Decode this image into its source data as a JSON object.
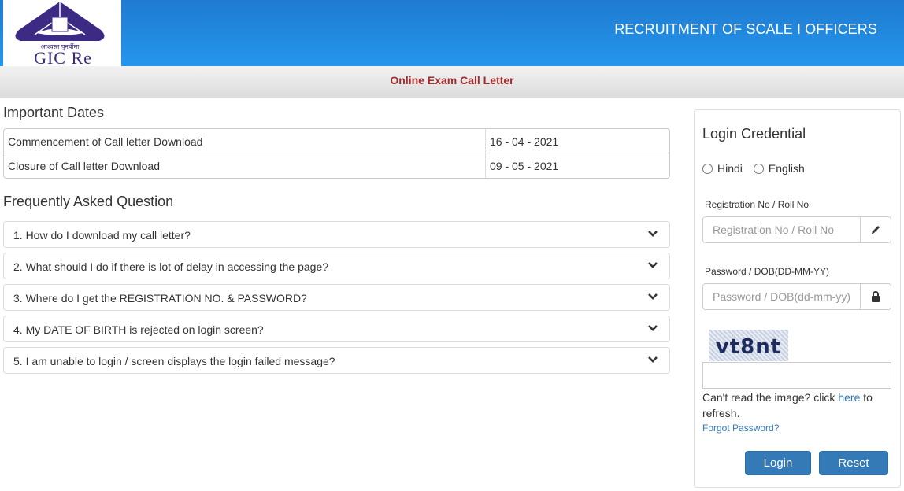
{
  "header": {
    "logo_text": "GIC Re",
    "logo_subtext": "आश्वस्त पुनर्बीमा",
    "title": "RECRUITMENT OF SCALE I OFFICERS",
    "colors": {
      "header_blue": "#2496ec",
      "subtitle_red": "#a52a2a",
      "button_blue": "#337ab7",
      "logo_purple": "#3d2a85"
    }
  },
  "subbar": {
    "title": "Online Exam Call Letter"
  },
  "important_dates": {
    "heading": "Important Dates",
    "rows": [
      {
        "label": "Commencement of Call letter Download",
        "value": "16 - 04 - 2021"
      },
      {
        "label": "Closure of Call letter Download",
        "value": "09 - 05 - 2021"
      }
    ]
  },
  "faq": {
    "heading": "Frequently Asked Question",
    "items": [
      {
        "question": "1. How do I download my call letter?",
        "icon": "chevron-down-icon"
      },
      {
        "question": "2. What should I do if there is lot of delay in accessing the page?",
        "icon": "chevron-down-icon"
      },
      {
        "question": "3. Where do I get the REGISTRATION NO. & PASSWORD?",
        "icon": "chevron-down-icon"
      },
      {
        "question": "4. My DATE OF BIRTH is rejected on login screen?",
        "icon": "chevron-down-icon"
      },
      {
        "question": "5. I am unable to login / screen displays the login failed message?",
        "icon": "chevron-down-icon"
      }
    ]
  },
  "login": {
    "title": "Login Credential",
    "languages": [
      {
        "label": "Hindi",
        "selected": false
      },
      {
        "label": "English",
        "selected": false
      }
    ],
    "registration": {
      "label": "Registration No / Roll No",
      "placeholder": "Registration No / Roll No",
      "value": "",
      "icon": "pencil-icon"
    },
    "password": {
      "label": "Password / DOB(DD-MM-YY)",
      "placeholder": "Password / DOB(dd-mm-yy)",
      "value": "",
      "icon": "lock-icon"
    },
    "captcha": {
      "text": "vt8nt",
      "input_value": ""
    },
    "refresh_prefix": "Can't read the image? click ",
    "refresh_link": "here",
    "refresh_suffix": " to refresh.",
    "forgot_password": "Forgot Password?",
    "login_button": "Login",
    "reset_button": "Reset"
  }
}
